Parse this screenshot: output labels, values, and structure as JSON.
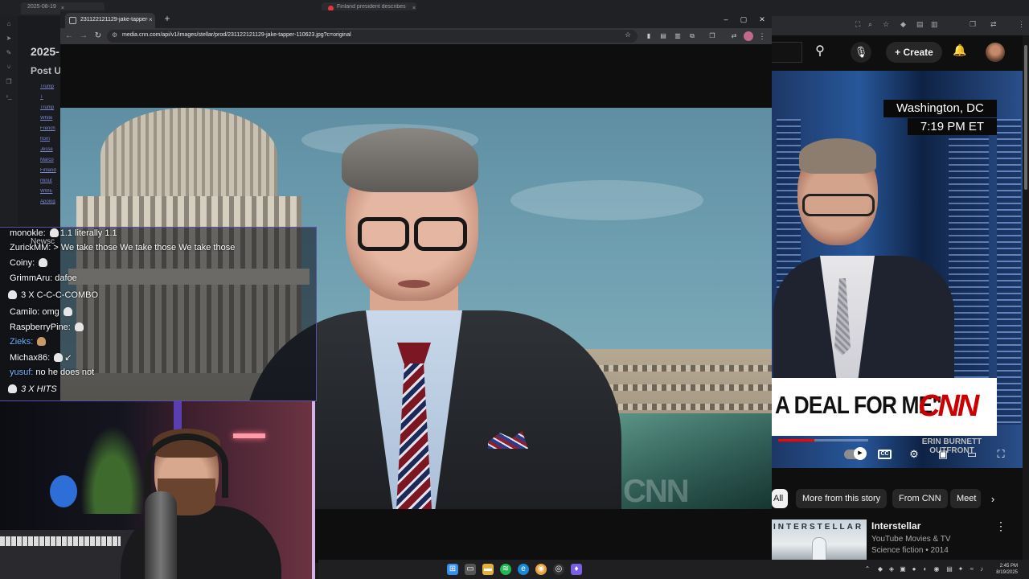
{
  "background_browser": {
    "tabs": [
      {
        "label": "2025-08-19",
        "close": "×"
      },
      {
        "label": "Finland president describes m",
        "close": "×"
      }
    ],
    "page_date": "2025-",
    "post_heading": "Post U",
    "links": [
      "Trump",
      "T",
      "Trump",
      "White",
      "French",
      "from",
      "Jesse",
      "Marco",
      "Finland",
      "minut",
      "WWE",
      "Apolog"
    ]
  },
  "main_window": {
    "tab_title": "231122121129-jake-tapper-11",
    "tab_close": "×",
    "new_tab": "+",
    "controls": {
      "minimize": "–",
      "maximize": "▢",
      "close": "✕"
    },
    "url": "media.cnn.com/api/v1/images/stellar/prod/231122121129-jake-tapper-110623.jpg?c=original",
    "watermark": "CNN"
  },
  "chat": {
    "lines": [
      {
        "user": "monokle:",
        "text": "1.1 literally 1.1"
      },
      {
        "user": "ZurickMM:",
        "text": "> We take those We take those We take those"
      },
      {
        "user": "Coiny:",
        "text": ""
      },
      {
        "user": "GrimmAru:",
        "text": "dafoe"
      },
      {
        "user": "Camilo:",
        "text": "omg"
      },
      {
        "user": "RaspberryPine:",
        "text": ""
      },
      {
        "user": "Zieks:",
        "text": ""
      },
      {
        "user": "Michax86:",
        "text": "↙"
      },
      {
        "user": "yusuf:",
        "text": "no he does not"
      }
    ],
    "combo1": "3 X C-C-C-COMBO",
    "combo2": "3 X HITS",
    "overlap_text": "Newsc"
  },
  "youtube": {
    "create_label": "Create",
    "location": "Washington, DC",
    "time": "7:19 PM ET",
    "lower_third": "A DEAL FOR ME\"",
    "cnn_logo": "CNN",
    "show": "ERIN BURNETT OUTFRONT",
    "cc_label": "CC",
    "chips": [
      "All",
      "More from this story",
      "From CNN",
      "Meet"
    ],
    "rec": {
      "thumb_title": "INTERSTELLAR",
      "title": "Interstellar",
      "channel": "YouTube Movies & TV",
      "meta": "Science fiction • 2014"
    }
  },
  "taskbar": {
    "time": "2:45 PM",
    "date": "8/19/2025"
  },
  "colors": {
    "chat_border": "#5e4fa8",
    "youtube_red": "#ff0000",
    "cnn_red": "#cc0000"
  }
}
